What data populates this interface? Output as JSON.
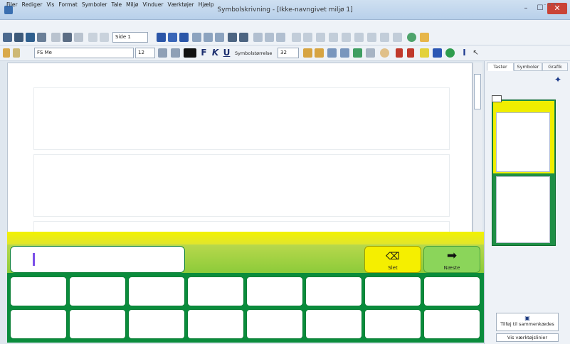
{
  "window": {
    "title": "Symbolskrivning - [Ikke-navngivet miljø 1]",
    "minimize_glyph": "–",
    "maximize_glyph": "☐",
    "close_glyph": "✕"
  },
  "menu": {
    "items": [
      "Filer",
      "Rediger",
      "Vis",
      "Format",
      "Symboler",
      "Tale",
      "Miljø",
      "Vinduer",
      "Værktøjer",
      "Hjælp"
    ],
    "mdi_controls": "– ▫ ×"
  },
  "toolbar1": {
    "page_select": "Side 1"
  },
  "toolbar2": {
    "font_select": "FS Me",
    "size_select": "12",
    "bold_label": "F",
    "italic_label": "K",
    "underline_label": "U",
    "symbol_size_label": "Symbolstørrelse",
    "symbol_size_value": "32"
  },
  "keyboard": {
    "slet_label": "Slet",
    "neste_label": "Næste",
    "neste_glyph": "➡",
    "slet_glyph": "⌫"
  },
  "right_panel": {
    "tabs": [
      "Taster",
      "Symboler",
      "Grafik"
    ],
    "add_button": "Tilføj til sammenkædes",
    "show_button": "Vis værktøjslinier"
  },
  "colors": {
    "keyboard_green": "#0a8c3c",
    "strip_lime": "#8ccb3a",
    "delete_yellow": "#f5ef00",
    "next_green": "#8bd55a",
    "close_red": "#c94336"
  }
}
